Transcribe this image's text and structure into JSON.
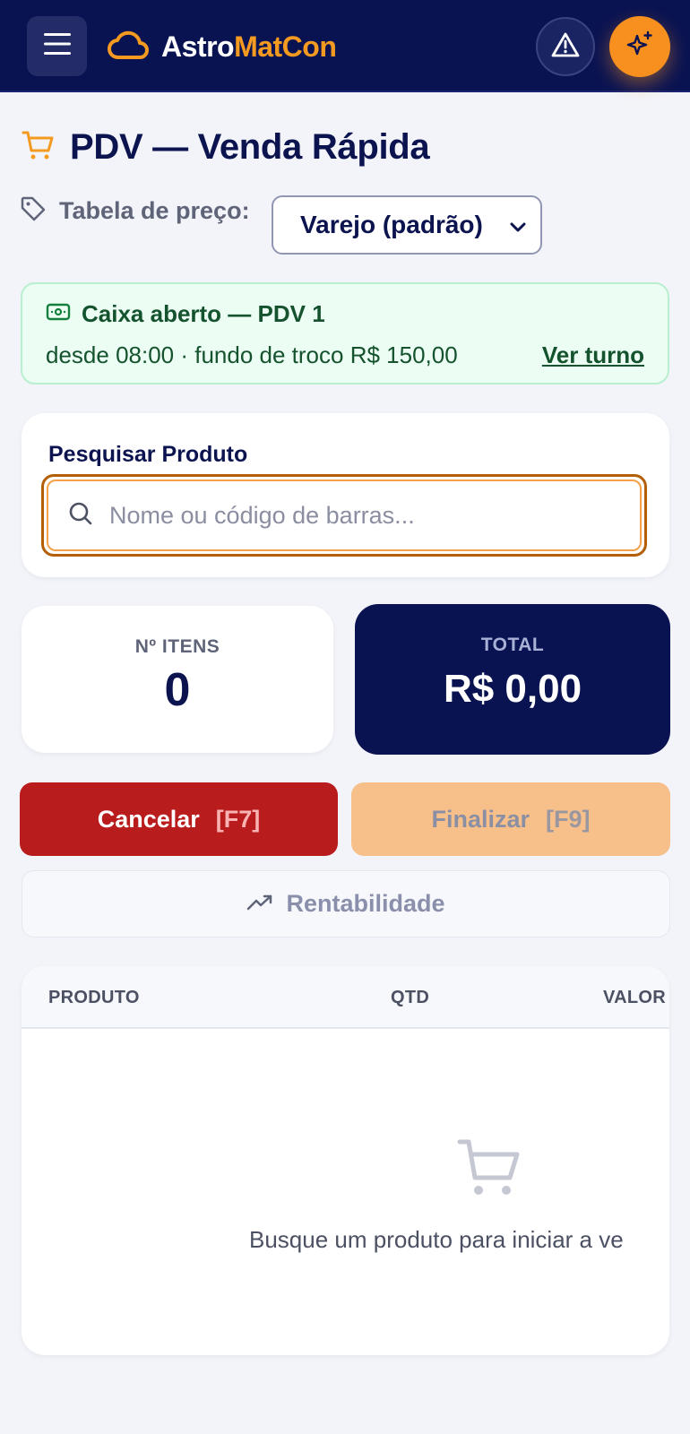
{
  "header": {
    "logo_part1": "Astro",
    "logo_part2": "MatCon",
    "icons": [
      "menu-icon",
      "cloud-logo-icon",
      "alert-triangle-icon",
      "sparkles-icon"
    ]
  },
  "page": {
    "title": "PDV — Venda Rápida",
    "title_icon": "shopping-cart-icon"
  },
  "price_table": {
    "label": "Tabela de preço:",
    "selected": "Varejo (padrão)",
    "icon": "tag-icon"
  },
  "cash_register": {
    "title": "Caixa aberto — PDV 1",
    "subtitle": "desde 08:00 · fundo de troco R$ 150,00",
    "link": "Ver turno",
    "icon": "banknote-icon"
  },
  "search": {
    "label": "Pesquisar Produto",
    "value": "",
    "placeholder": "Nome ou código de barras..."
  },
  "stats": {
    "items_label": "Nº ITENS",
    "items_value": "0",
    "total_label": "TOTAL",
    "total_value": "R$ 0,00"
  },
  "actions": {
    "cancel_label": "Cancelar",
    "cancel_key": "[F7]",
    "finish_label": "Finalizar",
    "finish_key": "[F9]",
    "profit_label": "Rentabilidade"
  },
  "table": {
    "columns": [
      "PRODUTO",
      "QTD",
      "VALOR"
    ],
    "empty_text": "Busque um produto para iniciar a ve"
  },
  "colors": {
    "navy": "#0a1352",
    "orange": "#f7901e",
    "red": "#b91c1c",
    "green_bg": "#ecfdf3",
    "green_text": "#14532d"
  }
}
